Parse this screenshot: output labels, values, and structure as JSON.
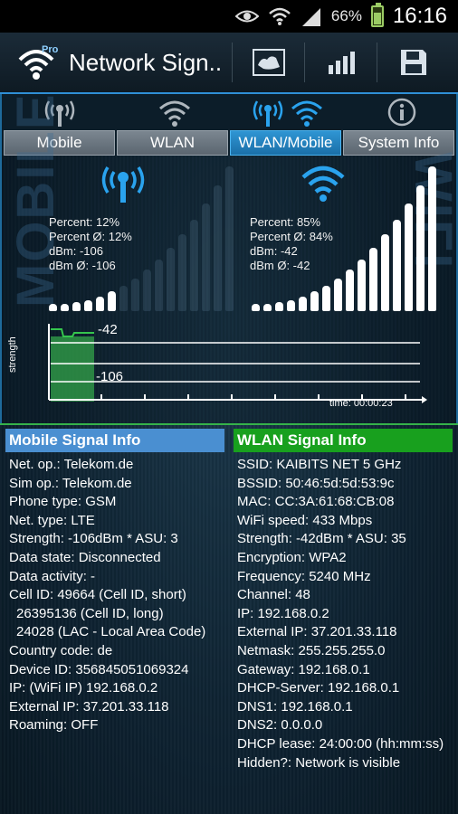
{
  "status_bar": {
    "battery": "66%",
    "time": "16:16"
  },
  "app": {
    "title": "Network Sign..",
    "logo_badge": "Pro"
  },
  "tabs": [
    {
      "label": "Mobile"
    },
    {
      "label": "WLAN"
    },
    {
      "label": "WLAN/Mobile"
    },
    {
      "label": "System Info"
    }
  ],
  "side_words": {
    "left": "MOBILE",
    "right": "WIFI"
  },
  "mobile_meter": {
    "percent": "Percent: 12%",
    "percent_avg": "Percent Ø: 12%",
    "dbm": "dBm: -106",
    "dbm_avg": "dBm Ø: -106",
    "level": 0.12
  },
  "wifi_meter": {
    "percent": "Percent: 85%",
    "percent_avg": "Percent Ø: 84%",
    "dbm": "dBm: -42",
    "dbm_avg": "dBm Ø: -42",
    "level": 0.85
  },
  "graph": {
    "y_label": "strength",
    "label_wifi": "-42",
    "label_mobile": "-106",
    "time": "time: 00:00:23"
  },
  "mobile_info": {
    "header": "Mobile Signal Info",
    "lines": [
      "Net. op.: Telekom.de",
      "Sim op.: Telekom.de",
      "Phone type: GSM",
      "Net. type: LTE",
      "Strength: -106dBm * ASU: 3",
      "Data state: Disconnected",
      "Data activity: -",
      "Cell ID: 49664 (Cell ID, short)",
      "26395136 (Cell ID, long)",
      "24028 (LAC - Local Area Code)",
      "Country code: de",
      "Device ID: 356845051069324",
      "IP: (WiFi IP) 192.168.0.2",
      "External IP: 37.201.33.118",
      "Roaming: OFF"
    ]
  },
  "wlan_info": {
    "header": "WLAN Signal Info",
    "lines": [
      "SSID: KAIBITS NET 5 GHz",
      "BSSID: 50:46:5d:5d:53:9c",
      "MAC: CC:3A:61:68:CB:08",
      "WiFi speed: 433 Mbps",
      "Strength: -42dBm * ASU: 35",
      "Encryption: WPA2",
      "Frequency: 5240 MHz",
      "Channel: 48",
      "IP: 192.168.0.2",
      "External IP: 37.201.33.118",
      "Netmask: 255.255.255.0",
      "Gateway: 192.168.0.1",
      "DHCP-Server: 192.168.0.1",
      "DNS1: 192.168.0.1",
      "DNS2: 0.0.0.0",
      "DHCP lease: 24:00:00 (hh:mm:ss)",
      "Hidden?: Network is visible"
    ]
  },
  "colors": {
    "mobile_header": "#4a8fd1",
    "wlan_header": "#18a01e",
    "accent": "#2f95d3",
    "icon_blue": "#2aa3ee"
  }
}
